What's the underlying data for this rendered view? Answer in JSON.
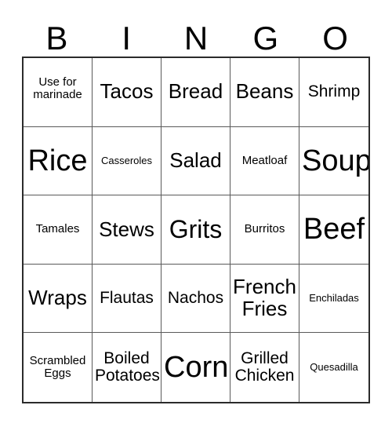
{
  "card": {
    "title": "BINGO",
    "header_letters": [
      "B",
      "I",
      "N",
      "G",
      "O"
    ],
    "rows": 5,
    "columns": 5,
    "colors": {
      "background": "#ffffff",
      "text": "#000000",
      "outer_border": "#2b2b2b",
      "inner_border": "#5a5a5a"
    },
    "cells": [
      {
        "text": "Use for\nmarinade",
        "size": "sm",
        "lines": 2
      },
      {
        "text": "Tacos",
        "size": "lg",
        "lines": 1
      },
      {
        "text": "Bread",
        "size": "lg",
        "lines": 1
      },
      {
        "text": "Beans",
        "size": "lg",
        "lines": 1
      },
      {
        "text": "Shrimp",
        "size": "md",
        "lines": 1
      },
      {
        "text": "Rice",
        "size": "xxl",
        "lines": 1
      },
      {
        "text": "Casseroles",
        "size": "xs",
        "lines": 1
      },
      {
        "text": "Salad",
        "size": "lg",
        "lines": 1
      },
      {
        "text": "Meatloaf",
        "size": "sm",
        "lines": 1
      },
      {
        "text": "Soup",
        "size": "xxl",
        "lines": 1
      },
      {
        "text": "Tamales",
        "size": "sm",
        "lines": 1
      },
      {
        "text": "Stews",
        "size": "lg",
        "lines": 1
      },
      {
        "text": "Grits",
        "size": "xl",
        "lines": 1
      },
      {
        "text": "Burritos",
        "size": "sm",
        "lines": 1
      },
      {
        "text": "Beef",
        "size": "xxl",
        "lines": 1
      },
      {
        "text": "Wraps",
        "size": "lg",
        "lines": 1
      },
      {
        "text": "Flautas",
        "size": "md",
        "lines": 1
      },
      {
        "text": "Nachos",
        "size": "md",
        "lines": 1
      },
      {
        "text": "French\nFries",
        "size": "lg",
        "lines": 2
      },
      {
        "text": "Enchiladas",
        "size": "xs",
        "lines": 1
      },
      {
        "text": "Scrambled\nEggs",
        "size": "sm",
        "lines": 2
      },
      {
        "text": "Boiled\nPotatoes",
        "size": "md",
        "lines": 2
      },
      {
        "text": "Corn",
        "size": "xxl",
        "lines": 1
      },
      {
        "text": "Grilled\nChicken",
        "size": "md",
        "lines": 2
      },
      {
        "text": "Quesadilla",
        "size": "xs",
        "lines": 1
      }
    ]
  }
}
